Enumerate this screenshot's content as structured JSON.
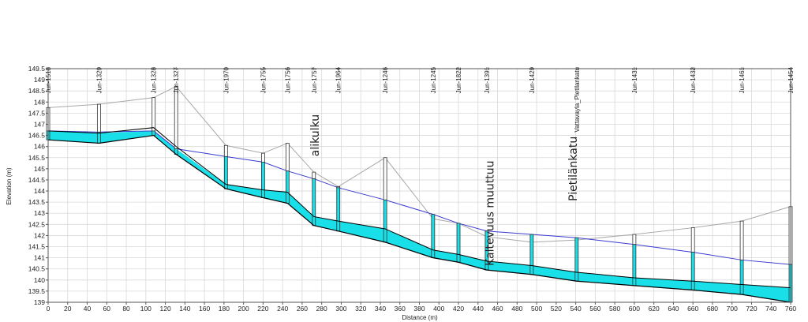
{
  "chart_data": {
    "type": "line",
    "title": "",
    "xlabel": "Distance (m)",
    "ylabel": "Elevation (m)",
    "xlim": [
      0,
      760
    ],
    "ylim": [
      139,
      149.5
    ],
    "x_ticks": [
      0,
      20,
      40,
      60,
      80,
      100,
      120,
      140,
      160,
      180,
      200,
      220,
      240,
      260,
      280,
      300,
      320,
      340,
      360,
      380,
      400,
      420,
      440,
      460,
      480,
      500,
      520,
      540,
      560,
      580,
      600,
      620,
      640,
      660,
      680,
      700,
      720,
      740,
      760
    ],
    "y_ticks": [
      139,
      139.5,
      140,
      140.5,
      141,
      141.5,
      142,
      142.5,
      143,
      143.5,
      144,
      144.5,
      145,
      145.5,
      146,
      146.5,
      147,
      147.5,
      148,
      148.5,
      149,
      149.5
    ],
    "grid": true,
    "colors": {
      "water_fill": "#19e0e8",
      "hydraulic_grade_line": "#3a3ad0",
      "ground_line": "#a8a8a8",
      "pipe_edge": "#000000",
      "gridline": "#d9d9d9"
    },
    "nodes": [
      {
        "name": "Jun-1518",
        "x": 0,
        "ground": 147.75,
        "top": 146.7,
        "invert": 146.3,
        "hgl": 146.7
      },
      {
        "name": "Jun-1329",
        "x": 52,
        "ground": 147.9,
        "top": 146.6,
        "invert": 146.15,
        "hgl": 146.65
      },
      {
        "name": "Jun-1328",
        "x": 108,
        "ground": 148.2,
        "top": 146.85,
        "invert": 146.5,
        "hgl": 146.7
      },
      {
        "name": "Jun-1327",
        "x": 131,
        "ground": 148.7,
        "top": 146.0,
        "invert": 145.65,
        "hgl": 145.9
      },
      {
        "name": "Jun-1970",
        "x": 182,
        "ground": 146.05,
        "top": 144.3,
        "invert": 144.1,
        "hgl": 145.55
      },
      {
        "name": "Jun-1755",
        "x": 220,
        "ground": 145.7,
        "top": 144.05,
        "invert": 143.7,
        "hgl": 145.3
      },
      {
        "name": "Jun-1756",
        "x": 245,
        "ground": 146.15,
        "top": 143.95,
        "invert": 143.45,
        "hgl": 144.9
      },
      {
        "name": "Jun-1757",
        "x": 272,
        "ground": 144.85,
        "top": 142.85,
        "invert": 142.45,
        "hgl": 144.55
      },
      {
        "name": "Jun-1964",
        "x": 297,
        "ground": 144.2,
        "top": 142.65,
        "invert": 142.2,
        "hgl": 144.15
      },
      {
        "name": "Jun-1246",
        "x": 345,
        "ground": 145.5,
        "top": 142.3,
        "invert": 141.7,
        "hgl": 143.6
      },
      {
        "name": "Jun-1245",
        "x": 394,
        "ground": 142.75,
        "top": 141.35,
        "invert": 141.0,
        "hgl": 142.95
      },
      {
        "name": "Jun-1822",
        "x": 420,
        "ground": 142.55,
        "top": 141.15,
        "invert": 140.8,
        "hgl": 142.55
      },
      {
        "name": "Jun-1391",
        "x": 449,
        "ground": 141.95,
        "top": 140.85,
        "invert": 140.45,
        "hgl": 142.2
      },
      {
        "name": "Jun-1429",
        "x": 495,
        "ground": 141.7,
        "top": 140.65,
        "invert": 140.25,
        "hgl": 142.05
      },
      {
        "name": "Vattavayla_Pietilankatu",
        "x": 541,
        "ground": 141.8,
        "top": 140.35,
        "invert": 139.95,
        "hgl": 141.9
      },
      {
        "name": "Jun-1431",
        "x": 600,
        "ground": 142.05,
        "top": 140.1,
        "invert": 139.75,
        "hgl": 141.6
      },
      {
        "name": "Jun-1432",
        "x": 660,
        "ground": 142.35,
        "top": 139.95,
        "invert": 139.55,
        "hgl": 141.25
      },
      {
        "name": "Jun-1461",
        "x": 710,
        "ground": 142.65,
        "top": 139.8,
        "invert": 139.35,
        "hgl": 140.9
      },
      {
        "name": "Jun-1454",
        "x": 760,
        "ground": 143.3,
        "top": 139.65,
        "invert": 139.0,
        "hgl": 140.7
      }
    ],
    "annotations": [
      {
        "text": "alikulku",
        "x": 277,
        "y": 146.5
      },
      {
        "text": "Kaltevuus muuttuu",
        "x": 456,
        "y": 143.0
      },
      {
        "text": "Pietilänkatu",
        "x": 541,
        "y": 145.0
      }
    ]
  }
}
